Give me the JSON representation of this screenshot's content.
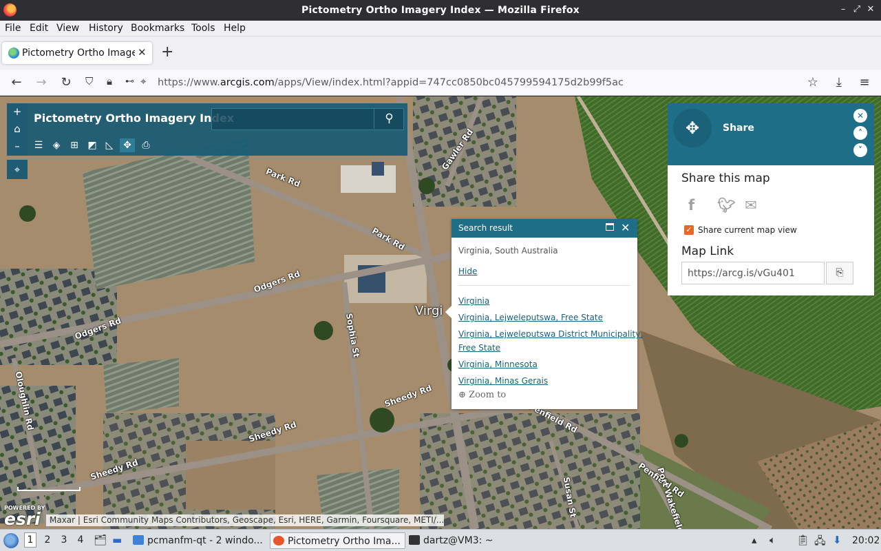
{
  "window": {
    "title": "Pictometry Ortho Imagery Index — Mozilla Firefox"
  },
  "menu": [
    "File",
    "Edit",
    "View",
    "History",
    "Bookmarks",
    "Tools",
    "Help"
  ],
  "tab": {
    "label": "Pictometry Ortho Imagery Index",
    "close": "✕",
    "new_tab": "+"
  },
  "url": {
    "prefix": "https://www.",
    "domain": "arcgis.com",
    "path": "/apps/View/index.html?appid=747cc0850bc045799594175d2b99f5ac"
  },
  "app": {
    "title": "Pictometry Ortho Imagery Index",
    "search_value": "",
    "zoom_in": "+",
    "zoom_out": "–"
  },
  "share": {
    "header": "Share",
    "heading": "Share this map",
    "checkbox_label": "Share current map view",
    "checkbox_checked": true,
    "map_link_heading": "Map Link",
    "map_link_value": "https://arcg.is/vGu401"
  },
  "popup": {
    "title": "Search result",
    "main": "Virginia, South Australia",
    "hide": "Hide",
    "results": [
      "Virginia",
      "Virginia, Lejweleputswa, Free State",
      "Virginia, Lejweleputswa District Municipality,",
      "Free State",
      "Virginia, Minnesota",
      "Virginia, Minas Gerais"
    ],
    "zoom_to": "Zoom to"
  },
  "map": {
    "place_label": "Virgi",
    "roads": [
      "Park Rd",
      "Park Rd",
      "Gawler Rd",
      "Odgers Rd",
      "Odgers Rd",
      "Sophia St",
      "Sheedy Rd",
      "Sheedy Rd",
      "Sheedy Rd",
      "Oloughlin Rd",
      "Penfield Rd",
      "Penfield Rd",
      "Susan St",
      "Port Wakefield Rd"
    ],
    "powered_by": "POWERED BY",
    "esri_logo": "esri",
    "attribution": "Maxar | Esri Community Maps Contributors, Geoscape, Esri, HERE, Garmin, Foursquare, METI/..."
  },
  "taskbar": {
    "workspaces": [
      "1",
      "2",
      "3",
      "4"
    ],
    "items": [
      "pcmanfm-qt - 2 windo...",
      "Pictometry Ortho Ima...",
      "dartz@VM3: ~"
    ],
    "clock": "20:02"
  }
}
